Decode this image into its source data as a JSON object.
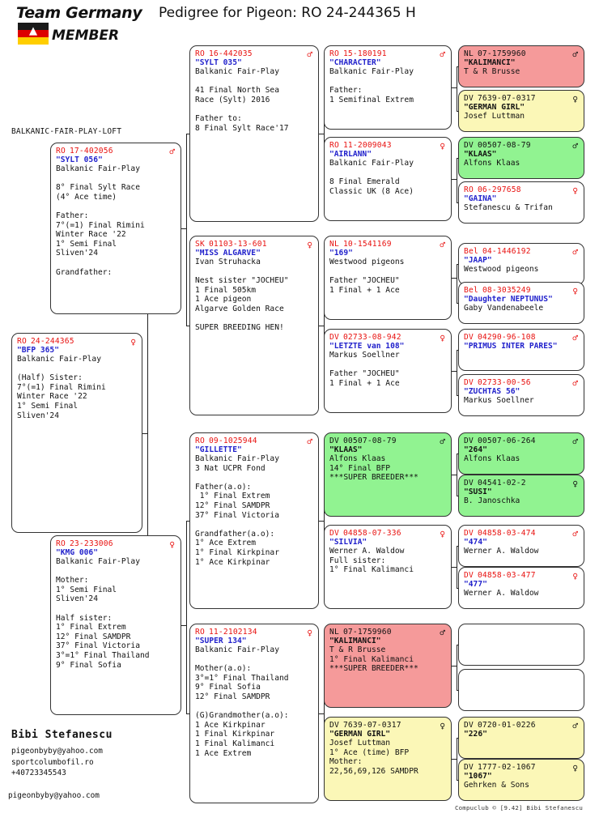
{
  "header": {
    "title": "Pedigree for Pigeon: RO  24-244365 H",
    "logo_line1": "Team Germany",
    "logo_line2": "MEMBER",
    "loft_name": "BALKANIC-FAIR-PLAY-LOFT"
  },
  "footer": {
    "owner": "Bibi Stefanescu",
    "email": "pigeonbyby@yahoo.com",
    "website": "sportcolumbofil.ro",
    "phone": "+40723345543",
    "email2": "pigeonbyby@yahoo.com",
    "credit": "Compuclub © [9.42]  Bibi Stefanescu"
  },
  "symbols": {
    "male": "♂",
    "female": "♀"
  },
  "colors": {
    "ring_red": "#e8110f",
    "name_blue": "#2222cc",
    "box_red": "#f59a9a",
    "box_yellow": "#fbf7b7",
    "box_green": "#91f391",
    "border": "#333333"
  },
  "subject": {
    "country": "RO",
    "ring": "24-244365",
    "sex": "female",
    "name": "\"BFP 365\"",
    "lines": [
      "Balkanic Fair-Play",
      "",
      "(Half) Sister:",
      "7°(=1) Final Rimini",
      "Winter Race '22",
      "1° Semi Final",
      "Sliven'24"
    ]
  },
  "gen1": [
    {
      "country": "RO",
      "ring": "17-402056",
      "sex": "male",
      "name": "\"SYLT 056\"",
      "color": "white",
      "lines": [
        "Balkanic Fair-Play",
        "",
        "8° Final Sylt Race",
        "(4° Ace time)",
        "",
        "Father:",
        "7°(=1) Final Rimini",
        "Winter Race '22",
        "1° Semi Final",
        "Sliven'24",
        "",
        "Grandfather:"
      ]
    },
    {
      "country": "RO",
      "ring": "23-233006",
      "sex": "female",
      "name": "\"KMG 006\"",
      "color": "white",
      "lines": [
        "Balkanic Fair-Play",
        "",
        "Mother:",
        "1° Semi Final",
        "Sliven'24",
        "",
        "Half sister:",
        "1° Final Extrem",
        "12° Final SAMDPR",
        "37° Final Victoria",
        "3°=1° Final Thailand",
        "9° Final Sofia"
      ]
    }
  ],
  "gen2": [
    {
      "country": "RO",
      "ring": "16-442035",
      "sex": "male",
      "name": "\"SYLT 035\"",
      "color": "white",
      "lines": [
        "Balkanic Fair-Play",
        "",
        "41 Final North Sea",
        "Race (Sylt) 2016",
        "",
        "Father to:",
        "8 Final Sylt Race'17"
      ]
    },
    {
      "country": "SK",
      "ring": "01103-13-601",
      "sex": "female",
      "name": "\"MISS ALGARVE\"",
      "color": "white",
      "lines": [
        "Ivan Struhacka",
        "",
        "Nest sister \"JOCHEU\"",
        "1 Final 505km",
        "1 Ace pigeon",
        "Algarve Golden Race",
        "",
        "SUPER BREEDING HEN!"
      ]
    },
    {
      "country": "RO",
      "ring": "09-1025944",
      "sex": "male",
      "name": "\"GILLETTE\"",
      "color": "white",
      "lines": [
        "Balkanic Fair-Play",
        "3 Nat UCPR Fond",
        "",
        "Father(a.o):",
        " 1° Final Extrem",
        "12° Final SAMDPR",
        "37° Final Victoria",
        "",
        "Grandfather(a.o):",
        "1° Ace Extrem",
        "1° Final Kirkpinar",
        "1° Ace Kirkpinar"
      ]
    },
    {
      "country": "RO",
      "ring": "11-2102134",
      "sex": "female",
      "name": "\"SUPER 134\"",
      "color": "white",
      "lines": [
        "Balkanic Fair-Play",
        "",
        "Mother(a.o):",
        "3°=1° Final Thailand",
        "9° Final Sofia",
        "12° Final SAMDPR",
        "",
        "(G)Grandmother(a.o):",
        "1 Ace Kirkpinar",
        "1 Final Kirkpinar",
        "1 Final Kalimanci",
        "1 Ace Extrem"
      ]
    }
  ],
  "gen3": [
    {
      "country": "RO",
      "ring": "15-180191",
      "sex": "male",
      "name": "\"CHARACTER\"",
      "color": "white",
      "lines": [
        "Balkanic Fair-Play",
        "",
        "Father:",
        "1 Semifinal Extrem"
      ]
    },
    {
      "country": "RO",
      "ring": "11-2009043",
      "sex": "female",
      "name": "\"AIRLANN\"",
      "color": "white",
      "lines": [
        "Balkanic Fair-Play",
        "",
        "8 Final Emerald",
        "Classic UK (8 Ace)"
      ]
    },
    {
      "country": "NL",
      "ring": "10-1541169",
      "sex": "male",
      "name": "\"169\"",
      "color": "white",
      "lines": [
        "Westwood pigeons",
        "",
        "Father \"JOCHEU\"",
        "1 Final + 1 Ace"
      ]
    },
    {
      "country": "DV",
      "ring": "02733-08-942",
      "sex": "female",
      "name": "\"LETZTE van 108\"",
      "color": "white",
      "lines": [
        "Markus Soellner",
        "",
        "Father \"JOCHEU\"",
        "1 Final + 1 Ace"
      ]
    },
    {
      "country": "DV",
      "ring": "00507-08-79",
      "sex": "male",
      "name": "\"KLAAS\"",
      "color": "green",
      "lines": [
        "Alfons Klaas",
        "14° Final BFP",
        "***SUPER BREEDER***"
      ]
    },
    {
      "country": "DV",
      "ring": "04858-07-336",
      "sex": "female",
      "name": "\"SILVIA\"",
      "color": "white",
      "lines": [
        "Werner A. Waldow",
        "Full sister:",
        "1° Final Kalimanci"
      ]
    },
    {
      "country": "NL",
      "ring": "07-1759960",
      "sex": "male",
      "name": "\"KALIMANCI\"",
      "color": "red",
      "lines": [
        "T & R Brusse",
        "1° Final Kalimanci",
        "***SUPER BREEDER***"
      ]
    },
    {
      "country": "DV",
      "ring": "7639-07-0317",
      "sex": "female",
      "name": "\"GERMAN GIRL\"",
      "color": "yellow",
      "lines": [
        "Josef Luttman",
        "1° Ace (time) BFP",
        "Mother:",
        "22,56,69,126 SAMDPR"
      ]
    }
  ],
  "gen4": [
    {
      "country": "NL",
      "ring": "07-1759960",
      "sex": "male",
      "name": "\"KALIMANCI\"",
      "color": "red",
      "lines": [
        "T & R Brusse"
      ]
    },
    {
      "country": "DV",
      "ring": "7639-07-0317",
      "sex": "female",
      "name": "\"GERMAN GIRL\"",
      "color": "yellow",
      "lines": [
        "Josef Luttman"
      ]
    },
    {
      "country": "DV",
      "ring": "00507-08-79",
      "sex": "male",
      "name": "\"KLAAS\"",
      "color": "green",
      "lines": [
        "Alfons Klaas"
      ]
    },
    {
      "country": "RO",
      "ring": "06-297658",
      "sex": "female",
      "name": "\"GAINA\"",
      "color": "white",
      "lines": [
        "Stefanescu & Trifan"
      ]
    },
    {
      "country": "Bel",
      "ring": "04-1446192",
      "sex": "male",
      "name": "\"JAAP\"",
      "color": "white",
      "lines": [
        "Westwood pigeons"
      ]
    },
    {
      "country": "Bel",
      "ring": "08-3035249",
      "sex": "female",
      "name": "\"Daughter NEPTUNUS\"",
      "color": "white",
      "lines": [
        "Gaby Vandenabeele"
      ]
    },
    {
      "country": "DV",
      "ring": "04290-96-108",
      "sex": "male",
      "name": "\"PRIMUS INTER PARES\"",
      "color": "white",
      "lines": [
        ""
      ]
    },
    {
      "country": "DV",
      "ring": "02733-00-56",
      "sex": "male",
      "name": "\"ZUCHTAS 56\"",
      "color": "white",
      "lines": [
        "Markus Soellner"
      ]
    },
    {
      "country": "DV",
      "ring": "00507-06-264",
      "sex": "male",
      "name": "\"264\"",
      "color": "green",
      "lines": [
        "Alfons Klaas"
      ]
    },
    {
      "country": "DV",
      "ring": "04541-02-2",
      "sex": "female",
      "name": "\"SUSI\"",
      "color": "green",
      "lines": [
        "B. Janoschka"
      ]
    },
    {
      "country": "DV",
      "ring": "04858-03-474",
      "sex": "male",
      "name": "\"474\"",
      "color": "white",
      "lines": [
        "Werner A. Waldow"
      ]
    },
    {
      "country": "DV",
      "ring": "04858-03-477",
      "sex": "female",
      "name": "\"477\"",
      "color": "white",
      "lines": [
        "Werner A. Waldow"
      ]
    },
    {
      "country": "",
      "ring": "",
      "sex": "",
      "name": "",
      "color": "white",
      "lines": [
        ""
      ]
    },
    {
      "country": "",
      "ring": "",
      "sex": "",
      "name": "",
      "color": "white",
      "lines": [
        ""
      ]
    },
    {
      "country": "DV",
      "ring": "0720-01-0226",
      "sex": "male",
      "name": "\"226\"",
      "color": "yellow",
      "lines": [
        ""
      ]
    },
    {
      "country": "DV",
      "ring": "1777-02-1067",
      "sex": "female",
      "name": "\"1067\"",
      "color": "yellow",
      "lines": [
        "Gehrken & Sons"
      ]
    }
  ]
}
